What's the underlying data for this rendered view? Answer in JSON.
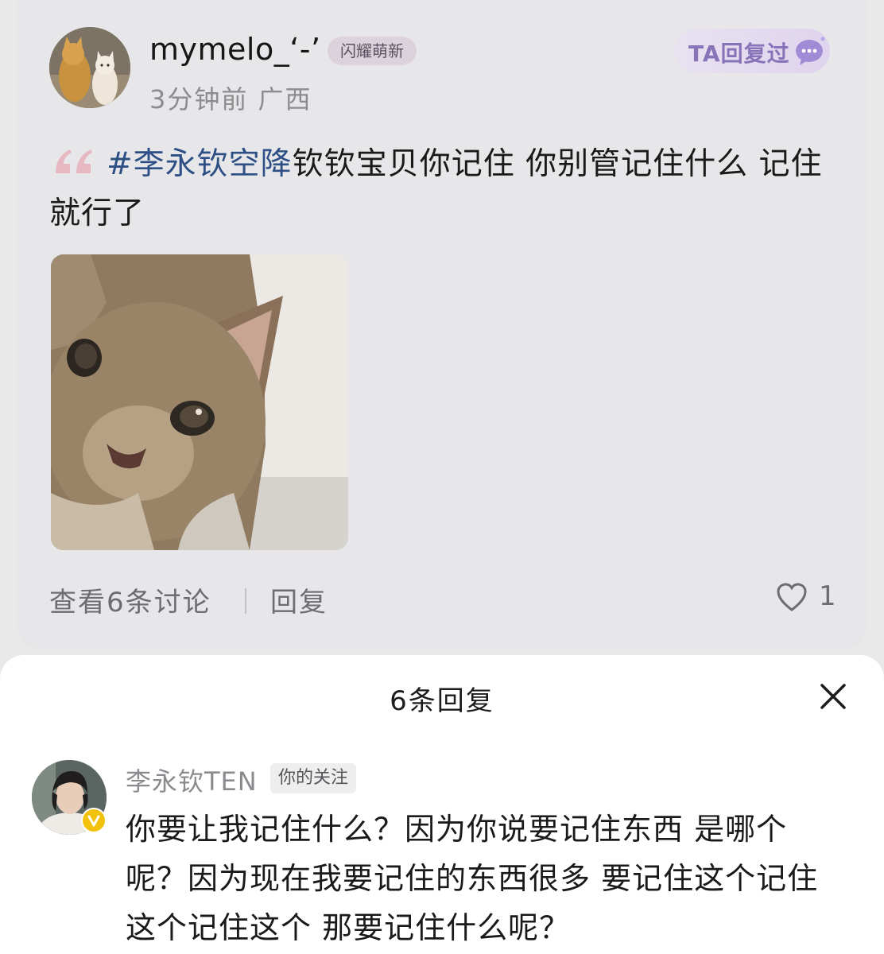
{
  "post": {
    "username": "mymelo_‘-’",
    "user_badge": "闪耀萌新",
    "time": "3分钟前",
    "location": "广西",
    "replied_badge": "TA回复过",
    "hashtag": "#李永钦空降",
    "content_text": "钦钦宝贝你记住 你别管记住什么 记住就行了",
    "view_discussion": "查看6条讨论",
    "reply_action": "回复",
    "like_count": "1"
  },
  "sheet": {
    "title": "6条回复",
    "reply": {
      "username": "李永钦TEN",
      "tag": "你的关注",
      "text": "你要让我记住什么？因为你说要记住东西 是哪个呢？因为现在我要记住的东西很多 要记住这个记住这个记住这个 那要记住什么呢？"
    }
  },
  "icons": {
    "replied": "chat-bubble-icon",
    "like": "heart-icon",
    "close": "close-icon",
    "quote": "quote-mark-icon",
    "verified": "verified-v-icon"
  },
  "colors": {
    "hashtag": "#2d4f86",
    "replied_badge": "#8773b8",
    "verified": "#f2c20a"
  }
}
